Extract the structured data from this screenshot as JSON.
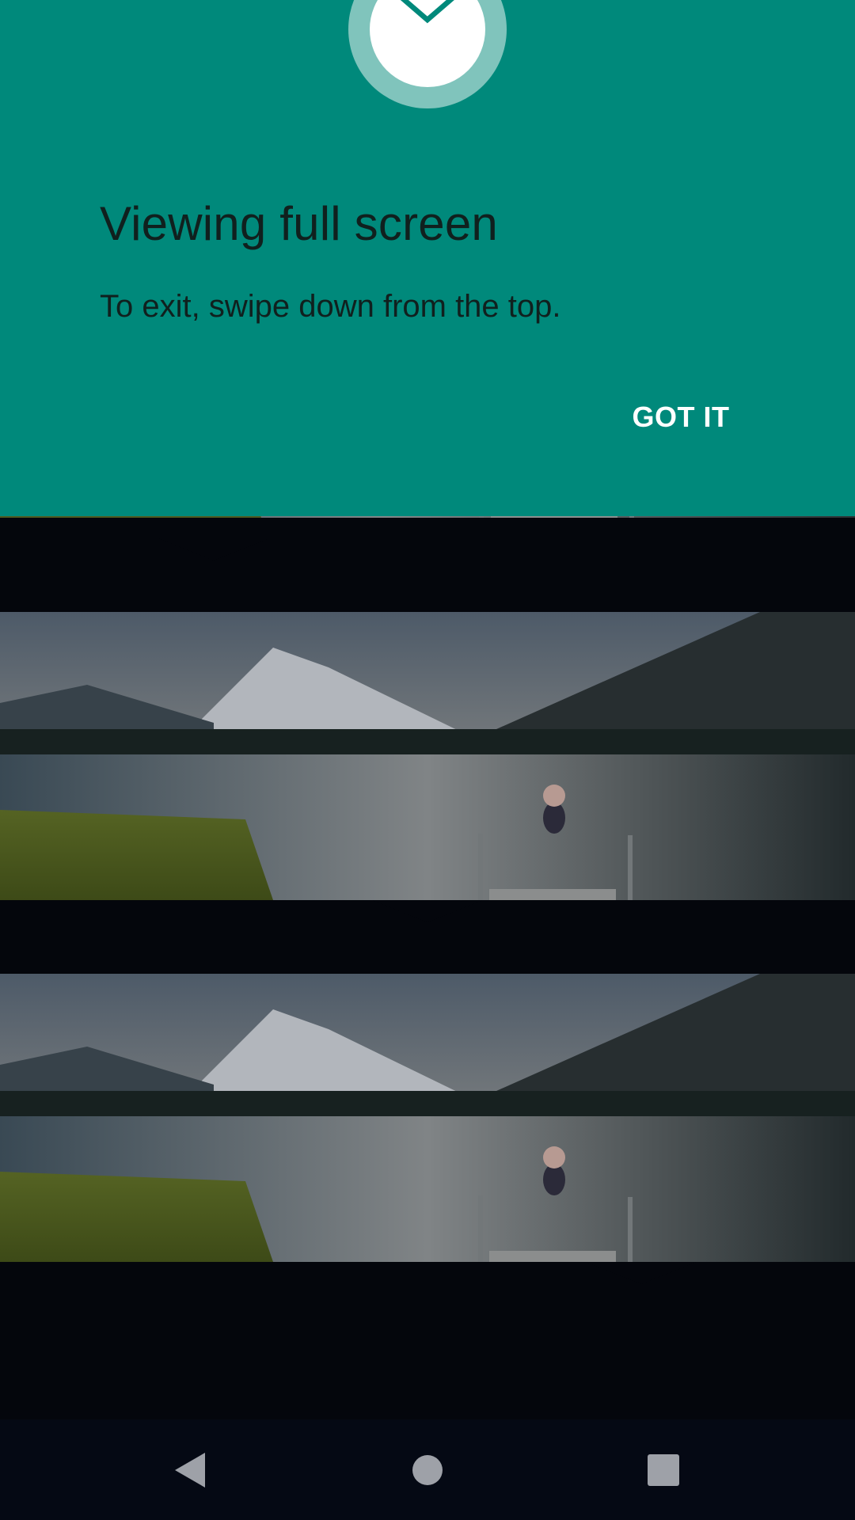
{
  "immersive_prompt": {
    "title": "Viewing full screen",
    "message": "To exit, swipe down from the top.",
    "confirm_label": "GOT IT",
    "badge_icon": "chevron-down-icon"
  },
  "feed": {
    "items": [
      {
        "name": "panorama-photo"
      },
      {
        "name": "panorama-photo"
      },
      {
        "name": "panorama-photo"
      }
    ]
  },
  "navigation_bar": {
    "back_icon": "back-triangle-icon",
    "home_icon": "home-circle-icon",
    "recents_icon": "recents-square-icon"
  },
  "colors": {
    "prompt_background": "#00897b",
    "prompt_badge_ring": "#80c4bc",
    "accent": "#00897b",
    "page_background": "#05070d",
    "nav_bar": "#050914",
    "nav_icons": "#9ea1a8"
  }
}
